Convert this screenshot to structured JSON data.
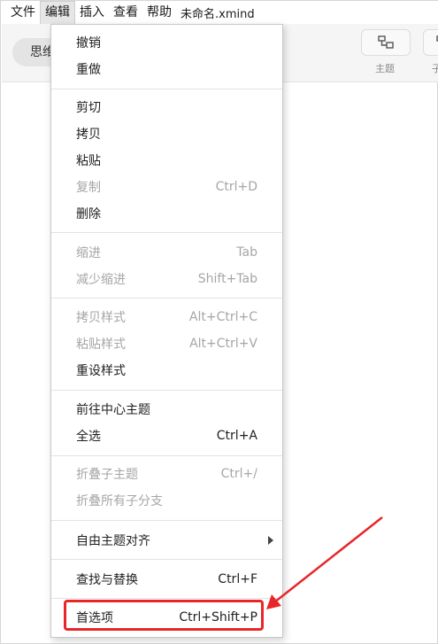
{
  "menubar": {
    "items": [
      "文件",
      "编辑",
      "插入",
      "查看",
      "帮助"
    ],
    "doc_title": "未命名.xmind"
  },
  "toolbar": {
    "pill_label": "思维",
    "topic_label": "主题",
    "next_label": "子"
  },
  "edit_menu": {
    "undo": "撤销",
    "redo": "重做",
    "cut": "剪切",
    "copy": "拷贝",
    "paste": "粘贴",
    "duplicate": "复制",
    "duplicate_sc": "Ctrl+D",
    "delete": "删除",
    "indent": "缩进",
    "indent_sc": "Tab",
    "outdent": "减少缩进",
    "outdent_sc": "Shift+Tab",
    "copy_style": "拷贝样式",
    "copy_style_sc": "Alt+Ctrl+C",
    "paste_style": "粘贴样式",
    "paste_style_sc": "Alt+Ctrl+V",
    "reset_style": "重设样式",
    "goto_central": "前往中心主题",
    "select_all": "全选",
    "select_all_sc": "Ctrl+A",
    "collapse_sub": "折叠子主题",
    "collapse_sub_sc": "Ctrl+/",
    "collapse_all": "折叠所有子分支",
    "free_align": "自由主题对齐",
    "find_replace": "查找与替换",
    "find_replace_sc": "Ctrl+F",
    "preferences": "首选项",
    "preferences_sc": "Ctrl+Shift+P"
  },
  "colors": {
    "annotation_red": "#e8262a",
    "disabled_text": "#a6a6a6"
  }
}
